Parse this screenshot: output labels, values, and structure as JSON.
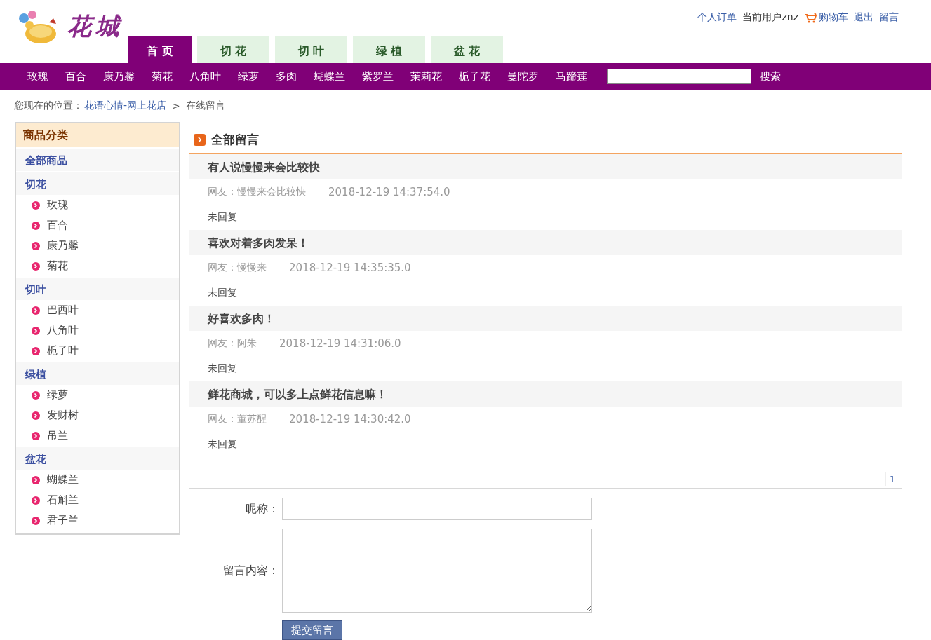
{
  "logo": {
    "text": "花城"
  },
  "top_links": [
    {
      "kind": "link",
      "label": "个人订单"
    },
    {
      "kind": "text",
      "label": "当前用户znz"
    },
    {
      "kind": "cart",
      "label": "购物车"
    },
    {
      "kind": "link",
      "label": "退出"
    },
    {
      "kind": "link",
      "label": "留言"
    }
  ],
  "tabs": [
    {
      "label": "首 页",
      "selected": true
    },
    {
      "label": "切 花",
      "selected": false
    },
    {
      "label": "切 叶",
      "selected": false
    },
    {
      "label": "绿 植",
      "selected": false
    },
    {
      "label": "盆 花",
      "selected": false
    }
  ],
  "nav_items": [
    "玫瑰",
    "百合",
    "康乃馨",
    "菊花",
    "八角叶",
    "绿萝",
    "多肉",
    "蝴蝶兰",
    "紫罗兰",
    "茉莉花",
    "栀子花",
    "曼陀罗",
    "马蹄莲"
  ],
  "search": {
    "button": "搜索"
  },
  "breadcrumb": {
    "prefix": "您现在的位置：",
    "link": "花语心情-网上花店",
    "separator": ">",
    "current": "在线留言"
  },
  "sidebar": {
    "title": "商品分类",
    "all": "全部商品",
    "categories": [
      {
        "name": "切花",
        "children": [
          "玫瑰",
          "百合",
          "康乃馨",
          "菊花"
        ]
      },
      {
        "name": "切叶",
        "children": [
          "巴西叶",
          "八角叶",
          "栀子叶"
        ]
      },
      {
        "name": "绿植",
        "children": [
          "绿萝",
          "发财树",
          "吊兰"
        ]
      },
      {
        "name": "盆花",
        "children": [
          "蝴蝶兰",
          "石斛兰",
          "君子兰"
        ]
      }
    ]
  },
  "messages_title": "全部留言",
  "messages": [
    {
      "title": "有人说慢慢来会比较快",
      "author": "网友：慢慢来会比较快",
      "time": "2018-12-19 14:37:54.0",
      "reply": "未回复"
    },
    {
      "title": "喜欢对着多肉发呆！",
      "author": "网友：慢慢来",
      "time": "2018-12-19 14:35:35.0",
      "reply": "未回复"
    },
    {
      "title": "好喜欢多肉！",
      "author": "网友：阿朱",
      "time": "2018-12-19 14:31:06.0",
      "reply": "未回复"
    },
    {
      "title": "鲜花商城，可以多上点鲜花信息嘛！",
      "author": "网友：董苏醒",
      "time": "2018-12-19 14:30:42.0",
      "reply": "未回复"
    }
  ],
  "pagination": [
    {
      "label": "1",
      "selected": true
    }
  ],
  "form": {
    "nickname_label": "昵称：",
    "content_label": "留言内容：",
    "submit": "提交留言"
  }
}
